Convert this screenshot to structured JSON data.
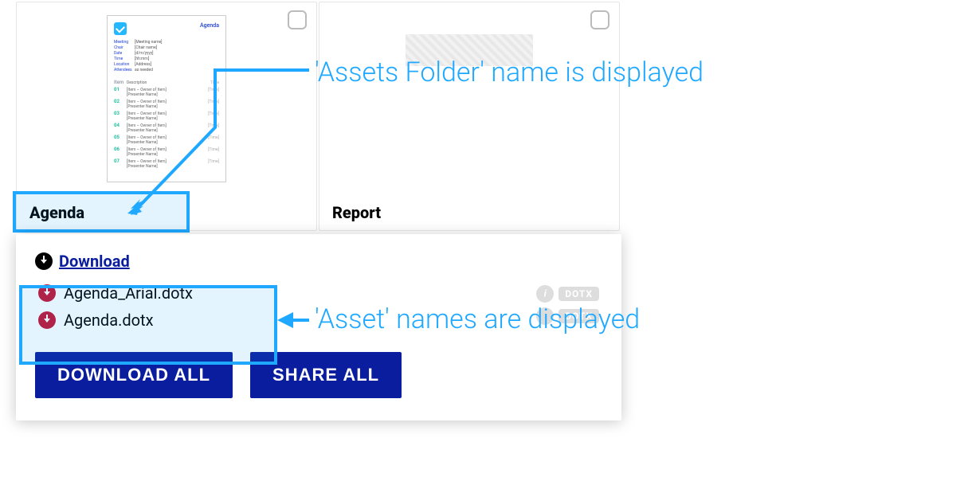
{
  "cards": {
    "agenda": {
      "title": "Agenda",
      "thumb_title": "Agenda"
    },
    "report": {
      "title": "Report"
    }
  },
  "popover": {
    "download_label": "Download",
    "assets": [
      {
        "filename": "Agenda_Arial.dotx"
      },
      {
        "filename": "Agenda.dotx"
      }
    ],
    "behind_badges": [
      {
        "ext": "DOTX"
      },
      {
        "ext": "DOTX"
      }
    ],
    "buttons": {
      "download_all": "DOWNLOAD ALL",
      "share_all": "SHARE ALL"
    }
  },
  "annotations": {
    "folder_name": "'Assets Folder' name is displayed",
    "asset_names": "'Asset' names are displayed"
  }
}
